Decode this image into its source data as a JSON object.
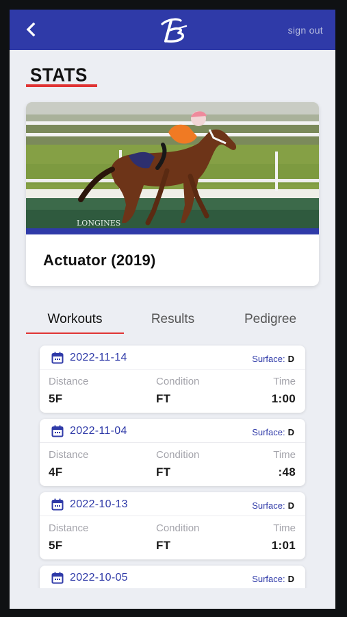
{
  "header": {
    "sign_out_label": "sign out",
    "logo_icon": "brand-b-logo",
    "back_icon": "chevron-left-icon",
    "color": "#2f3aa8"
  },
  "page": {
    "title": "STATS",
    "accent": "#e03333"
  },
  "horse": {
    "name": "Actuator (2019)",
    "photo_sign": "LONGINES"
  },
  "tabs": [
    {
      "label": "Workouts",
      "active": true
    },
    {
      "label": "Results",
      "active": false
    },
    {
      "label": "Pedigree",
      "active": false
    }
  ],
  "workouts": {
    "labels": {
      "surface": "Surface:",
      "distance": "Distance",
      "condition": "Condition",
      "time": "Time"
    },
    "items": [
      {
        "date": "2022-11-14",
        "surface": "D",
        "distance": "5F",
        "condition": "FT",
        "time": "1:00"
      },
      {
        "date": "2022-11-04",
        "surface": "D",
        "distance": "4F",
        "condition": "FT",
        "time": ":48"
      },
      {
        "date": "2022-10-13",
        "surface": "D",
        "distance": "5F",
        "condition": "FT",
        "time": "1:01"
      },
      {
        "date": "2022-10-05",
        "surface": "D",
        "distance": "",
        "condition": "",
        "time": ""
      }
    ]
  }
}
